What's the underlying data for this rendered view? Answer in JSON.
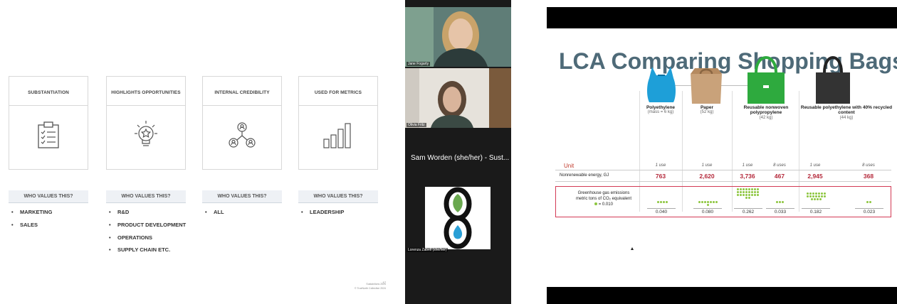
{
  "left_slide": {
    "cards": [
      {
        "title": "SUBSTANTIATION",
        "icon": "clipboard-checklist-icon",
        "who_label": "WHO VALUES THIS?",
        "bullets": [
          "MARKETING",
          "SALES"
        ]
      },
      {
        "title": "HIGHLIGHTS OPPORTUNITIES",
        "icon": "lightbulb-star-icon",
        "who_label": "WHO VALUES THIS?",
        "bullets": [
          "R&D",
          "PRODUCT DEVELOPMENT",
          "OPERATIONS",
          "SUPPLY CHAIN ETC."
        ]
      },
      {
        "title": "INTERNAL CREDIBILITY",
        "icon": "people-network-icon",
        "who_label": "WHO VALUES THIS?",
        "bullets": [
          "ALL"
        ]
      },
      {
        "title": "USED FOR METRICS",
        "icon": "bar-chart-icon",
        "who_label": "WHO VALUES THIS?",
        "bullets": [
          "LEADERSHIP"
        ]
      }
    ],
    "slide_number": "17",
    "footer_line1": "Sustainlions 2024",
    "footer_line2": "© TrueNorth Collective 2024"
  },
  "participants": [
    {
      "name": "Jane Fogarty"
    },
    {
      "name": "Olivia Fritz"
    },
    {
      "name": "Sam Worden (she/her) - Sust..."
    },
    {
      "name": "Lorenza Zabell (she/her)"
    }
  ],
  "right_slide": {
    "title": "LCA Comparing Shopping Bags",
    "bags": [
      {
        "name": "Polyethylene",
        "sub": "(mass = 6 kg)",
        "color": "#1e9fd8"
      },
      {
        "name": "Paper",
        "sub": "(52 kg)",
        "color": "#c9a27a"
      },
      {
        "name": "Reusable nonwoven polypropylene",
        "sub": "(42 kg)",
        "color": "#2eaa3e"
      },
      {
        "name": "Reusable polyethylene with 40% recycled content",
        "sub": "(44 kg)",
        "color": "#333333"
      }
    ],
    "unit_label": "Unit",
    "uses": [
      "1 use",
      "1 use",
      "1 use",
      "8 uses",
      "1 use",
      "8 uses"
    ],
    "energy_label": "Nonrenewable energy, GJ",
    "energy_values": [
      "763",
      "2,620",
      "3,736",
      "467",
      "2,945",
      "368"
    ],
    "ghg_label_line1": "Greenhouse gas emissions",
    "ghg_label_line2": "metric tons of CO₂ equivalent",
    "ghg_legend": "= 0.010",
    "ghg_values": [
      "0.040",
      "0.080",
      "0.262",
      "0.033",
      "0.182",
      "0.023"
    ],
    "accent_color": "#b4283a",
    "dot_color": "#8dc63f"
  }
}
